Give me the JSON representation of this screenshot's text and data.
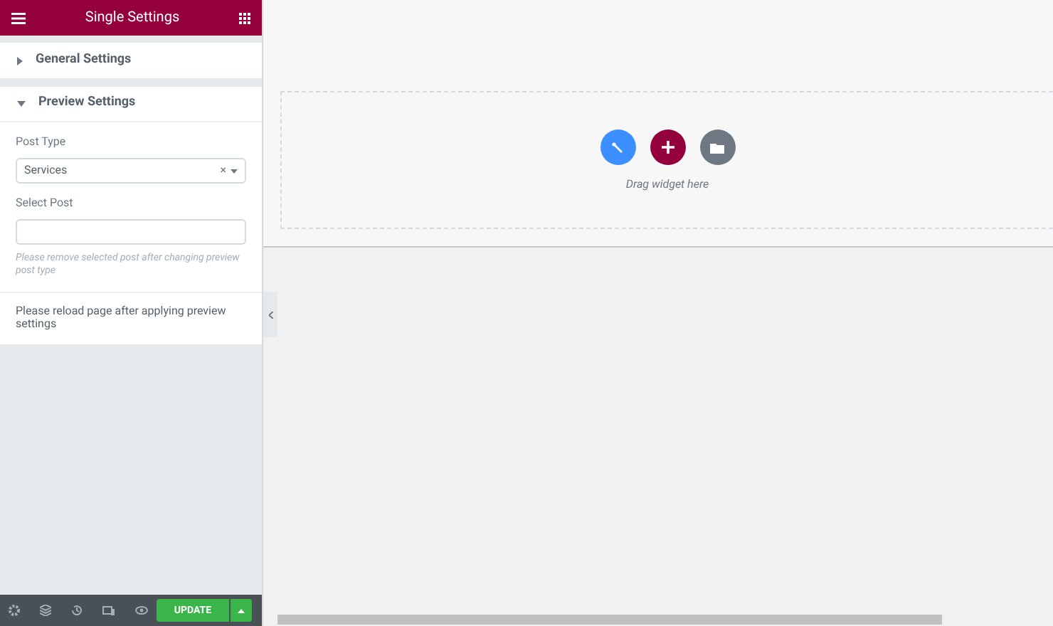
{
  "panel": {
    "title": "Single Settings"
  },
  "sections": [
    {
      "title": "General Settings",
      "expanded": false
    },
    {
      "title": "Preview Settings",
      "expanded": true
    }
  ],
  "preview": {
    "post_type_label": "Post Type",
    "post_type_value": "Services",
    "clear": "×",
    "select_post_label": "Select Post",
    "hint": "Please remove selected post after changing preview post type",
    "reload_note": "Please reload page after applying preview settings"
  },
  "footer": {
    "update": "UPDATE"
  },
  "canvas": {
    "drop_hint": "Drag widget here"
  }
}
